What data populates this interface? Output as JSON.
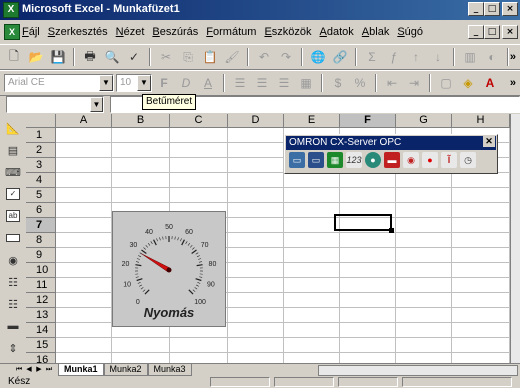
{
  "window": {
    "title": "Microsoft Excel - Munkafüzet1",
    "app_icon": "excel-icon",
    "controls": [
      "_",
      "□",
      "×"
    ]
  },
  "menubar": {
    "items": [
      "Fájl",
      "Szerkesztés",
      "Nézet",
      "Beszúrás",
      "Formátum",
      "Eszközök",
      "Adatok",
      "Ablak",
      "Súgó"
    ],
    "doc_controls": [
      "_",
      "□",
      "×"
    ]
  },
  "format_toolbar": {
    "font_name": "Arial CE",
    "font_size": "10",
    "bold": "F",
    "italic": "D",
    "underline": "A"
  },
  "tooltip": {
    "text": "Betűméret"
  },
  "namebox": {
    "value": ""
  },
  "sheet": {
    "columns": [
      "A",
      "B",
      "C",
      "D",
      "E",
      "F",
      "G",
      "H"
    ],
    "rows": [
      "1",
      "2",
      "3",
      "4",
      "5",
      "6",
      "7",
      "8",
      "9",
      "10",
      "11",
      "12",
      "13",
      "14",
      "15",
      "16"
    ],
    "active_column": "F",
    "active_row": "7"
  },
  "gauge": {
    "label": "Nyomás",
    "scale": [
      "0",
      "10",
      "20",
      "30",
      "40",
      "50",
      "60",
      "70",
      "80",
      "90",
      "100"
    ],
    "needle_value": 28
  },
  "opc_toolbar": {
    "title": "OMRON CX-Server OPC",
    "buttons": [
      "connect-icon",
      "disconnect-icon",
      "grid-icon",
      "numeric-icon",
      "globe-icon",
      "gauge-icon",
      "record-icon",
      "stop-icon",
      "thermometer-icon",
      "clock-icon"
    ]
  },
  "sheet_tabs": [
    "Munka1",
    "Munka2",
    "Munka3"
  ],
  "status": {
    "text": "Kész"
  }
}
